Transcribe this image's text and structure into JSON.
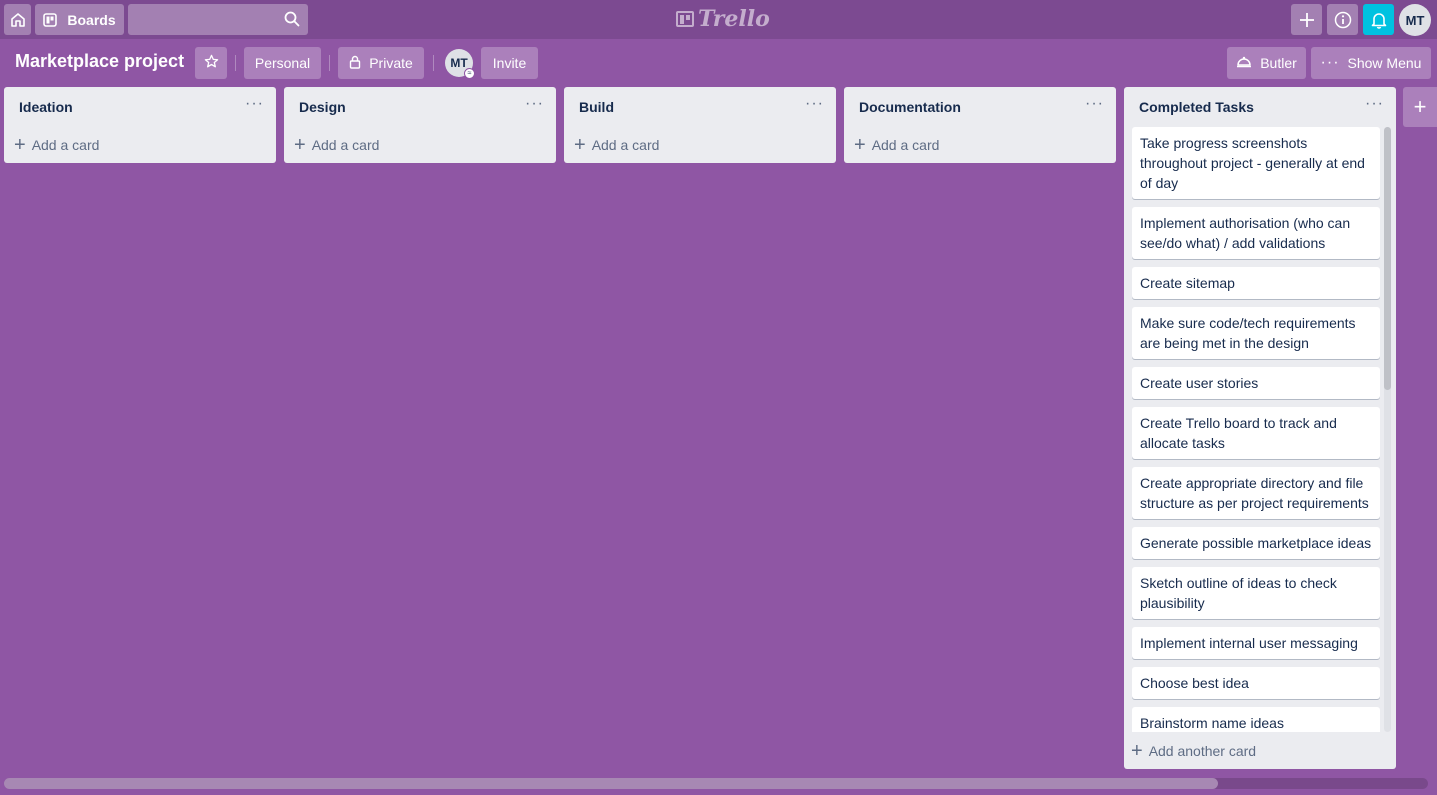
{
  "header": {
    "home_icon": "home-icon",
    "boards_label": "Boards",
    "search": {
      "value": "",
      "placeholder": ""
    },
    "logo_text": "Trello",
    "user_initials": "MT"
  },
  "board": {
    "title": "Marketplace project",
    "team_label": "Personal",
    "visibility_label": "Private",
    "member_initials": "MT",
    "invite_label": "Invite",
    "butler_label": "Butler",
    "show_menu_label": "Show Menu"
  },
  "lists": [
    {
      "title": "Ideation",
      "add_card_label": "Add a card"
    },
    {
      "title": "Design",
      "add_card_label": "Add a card"
    },
    {
      "title": "Build",
      "add_card_label": "Add a card"
    },
    {
      "title": "Documentation",
      "add_card_label": "Add a card"
    }
  ],
  "completed_list": {
    "title": "Completed Tasks",
    "add_card_label": "Add another card",
    "cards": [
      "Take progress screenshots throughout project - generally at end of day",
      "Implement authorisation (who can see/do what) / add validations",
      "Create sitemap",
      "Make sure code/tech requirements are being met in the design",
      "Create user stories",
      "Create Trello board to track and allocate tasks",
      "Create appropriate directory and file structure as per project requirements",
      "Generate possible marketplace ideas",
      "Sketch outline of ideas to check plausibility",
      "Implement internal user messaging",
      "Choose best idea",
      "Brainstorm name ideas"
    ]
  },
  "colors": {
    "board_background": "#8f56a4",
    "header_background": "#7c4a91",
    "list_background": "#ebecf0",
    "notification_accent": "#00c2e0"
  }
}
